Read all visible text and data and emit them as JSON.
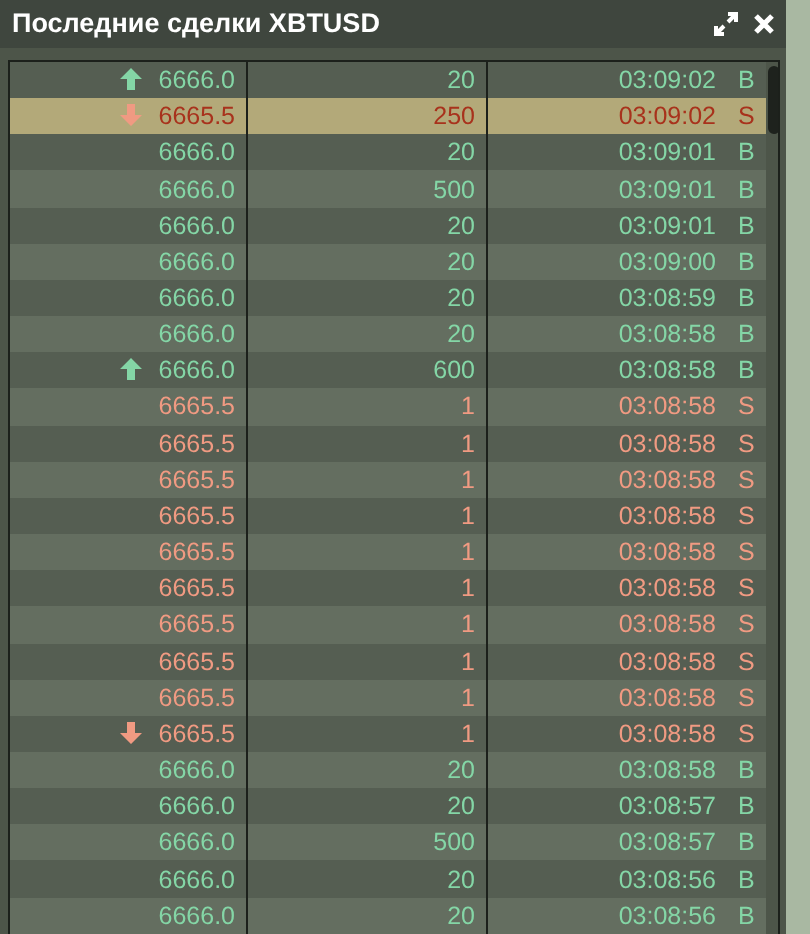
{
  "window": {
    "title": "Последние сделки XBTUSD"
  },
  "trades": [
    {
      "tick_up": true,
      "tick_down": false,
      "price": "6666.0",
      "size": "20",
      "time": "03:09:02",
      "side": "B",
      "highlighted": false
    },
    {
      "tick_up": false,
      "tick_down": true,
      "price": "6665.5",
      "size": "250",
      "time": "03:09:02",
      "side": "S",
      "highlighted": true
    },
    {
      "tick_up": false,
      "tick_down": false,
      "price": "6666.0",
      "size": "20",
      "time": "03:09:01",
      "side": "B",
      "highlighted": false
    },
    {
      "tick_up": false,
      "tick_down": false,
      "price": "6666.0",
      "size": "500",
      "time": "03:09:01",
      "side": "B",
      "highlighted": false
    },
    {
      "tick_up": false,
      "tick_down": false,
      "price": "6666.0",
      "size": "20",
      "time": "03:09:01",
      "side": "B",
      "highlighted": false
    },
    {
      "tick_up": false,
      "tick_down": false,
      "price": "6666.0",
      "size": "20",
      "time": "03:09:00",
      "side": "B",
      "highlighted": false
    },
    {
      "tick_up": false,
      "tick_down": false,
      "price": "6666.0",
      "size": "20",
      "time": "03:08:59",
      "side": "B",
      "highlighted": false
    },
    {
      "tick_up": false,
      "tick_down": false,
      "price": "6666.0",
      "size": "20",
      "time": "03:08:58",
      "side": "B",
      "highlighted": false
    },
    {
      "tick_up": true,
      "tick_down": false,
      "price": "6666.0",
      "size": "600",
      "time": "03:08:58",
      "side": "B",
      "highlighted": false
    },
    {
      "tick_up": false,
      "tick_down": false,
      "price": "6665.5",
      "size": "1",
      "time": "03:08:58",
      "side": "S",
      "highlighted": false
    },
    {
      "tick_up": false,
      "tick_down": false,
      "price": "6665.5",
      "size": "1",
      "time": "03:08:58",
      "side": "S",
      "highlighted": false
    },
    {
      "tick_up": false,
      "tick_down": false,
      "price": "6665.5",
      "size": "1",
      "time": "03:08:58",
      "side": "S",
      "highlighted": false
    },
    {
      "tick_up": false,
      "tick_down": false,
      "price": "6665.5",
      "size": "1",
      "time": "03:08:58",
      "side": "S",
      "highlighted": false
    },
    {
      "tick_up": false,
      "tick_down": false,
      "price": "6665.5",
      "size": "1",
      "time": "03:08:58",
      "side": "S",
      "highlighted": false
    },
    {
      "tick_up": false,
      "tick_down": false,
      "price": "6665.5",
      "size": "1",
      "time": "03:08:58",
      "side": "S",
      "highlighted": false
    },
    {
      "tick_up": false,
      "tick_down": false,
      "price": "6665.5",
      "size": "1",
      "time": "03:08:58",
      "side": "S",
      "highlighted": false
    },
    {
      "tick_up": false,
      "tick_down": false,
      "price": "6665.5",
      "size": "1",
      "time": "03:08:58",
      "side": "S",
      "highlighted": false
    },
    {
      "tick_up": false,
      "tick_down": false,
      "price": "6665.5",
      "size": "1",
      "time": "03:08:58",
      "side": "S",
      "highlighted": false
    },
    {
      "tick_up": false,
      "tick_down": true,
      "price": "6665.5",
      "size": "1",
      "time": "03:08:58",
      "side": "S",
      "highlighted": false
    },
    {
      "tick_up": false,
      "tick_down": false,
      "price": "6666.0",
      "size": "20",
      "time": "03:08:58",
      "side": "B",
      "highlighted": false
    },
    {
      "tick_up": false,
      "tick_down": false,
      "price": "6666.0",
      "size": "20",
      "time": "03:08:57",
      "side": "B",
      "highlighted": false
    },
    {
      "tick_up": false,
      "tick_down": false,
      "price": "6666.0",
      "size": "500",
      "time": "03:08:57",
      "side": "B",
      "highlighted": false
    },
    {
      "tick_up": false,
      "tick_down": false,
      "price": "6666.0",
      "size": "20",
      "time": "03:08:56",
      "side": "B",
      "highlighted": false
    },
    {
      "tick_up": false,
      "tick_down": false,
      "price": "6666.0",
      "size": "20",
      "time": "03:08:56",
      "side": "B",
      "highlighted": false
    }
  ]
}
